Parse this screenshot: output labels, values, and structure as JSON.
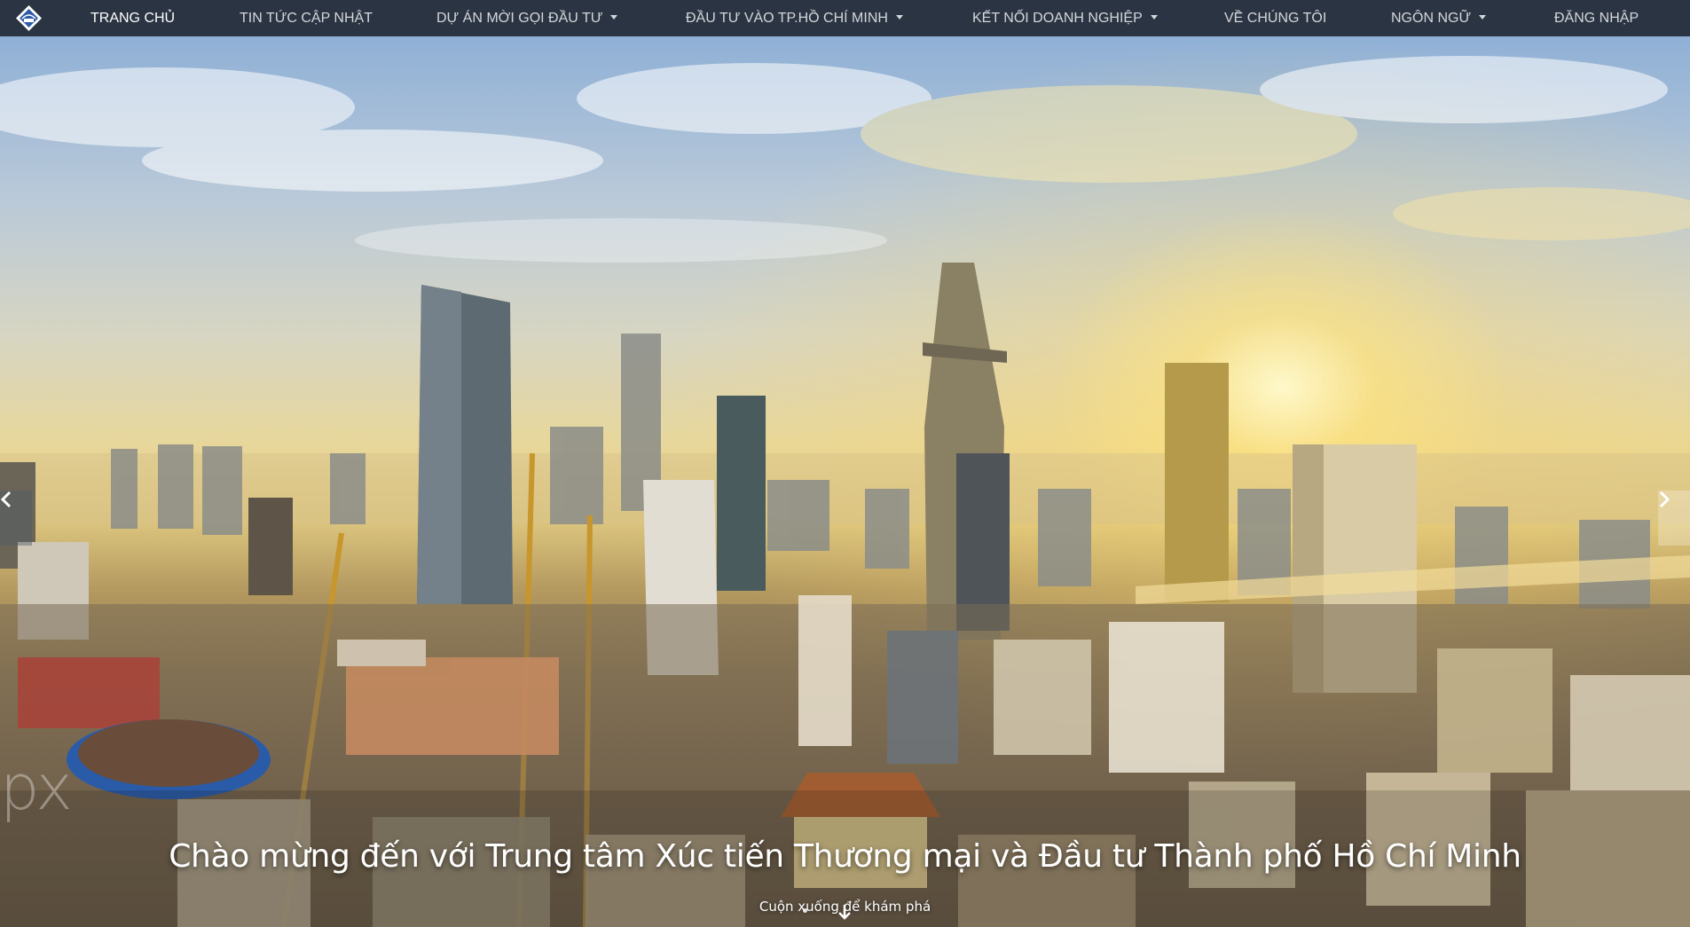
{
  "nav": {
    "logo_icon": "hcm-itpc-logo-icon",
    "items": [
      {
        "label": "TRANG CHỦ",
        "active": true,
        "dropdown": false
      },
      {
        "label": "TIN TỨC CẬP NHẬT",
        "active": false,
        "dropdown": false
      },
      {
        "label": "DỰ ÁN MỜI GỌI ĐẦU TƯ",
        "active": false,
        "dropdown": true
      },
      {
        "label": "ĐẦU TƯ VÀO TP.HỒ CHÍ MINH",
        "active": false,
        "dropdown": true
      },
      {
        "label": "KẾT NỐI DOANH NGHIỆP",
        "active": false,
        "dropdown": true
      },
      {
        "label": "VỀ CHÚNG TÔI",
        "active": false,
        "dropdown": false
      },
      {
        "label": "NGÔN NGỮ",
        "active": false,
        "dropdown": true
      },
      {
        "label": "ĐĂNG NHẬP",
        "active": false,
        "dropdown": false
      }
    ]
  },
  "hero": {
    "image": "ho-chi-minh-city-skyline-sunrise",
    "title": "Chào mừng đến với Trung tâm Xúc tiến Thương mại và Đầu tư Thành phố Hồ Chí Minh",
    "subtitle": "Cuộn xuống để khám phá",
    "watermark": "px",
    "prev_icon": "chevron-left-icon",
    "next_icon": "chevron-right-icon",
    "scroll_icon": "arrow-down-icon"
  },
  "colors": {
    "navbar_bg": "#2b3442",
    "nav_text": "#d4d7dc",
    "nav_active": "#ffffff"
  }
}
